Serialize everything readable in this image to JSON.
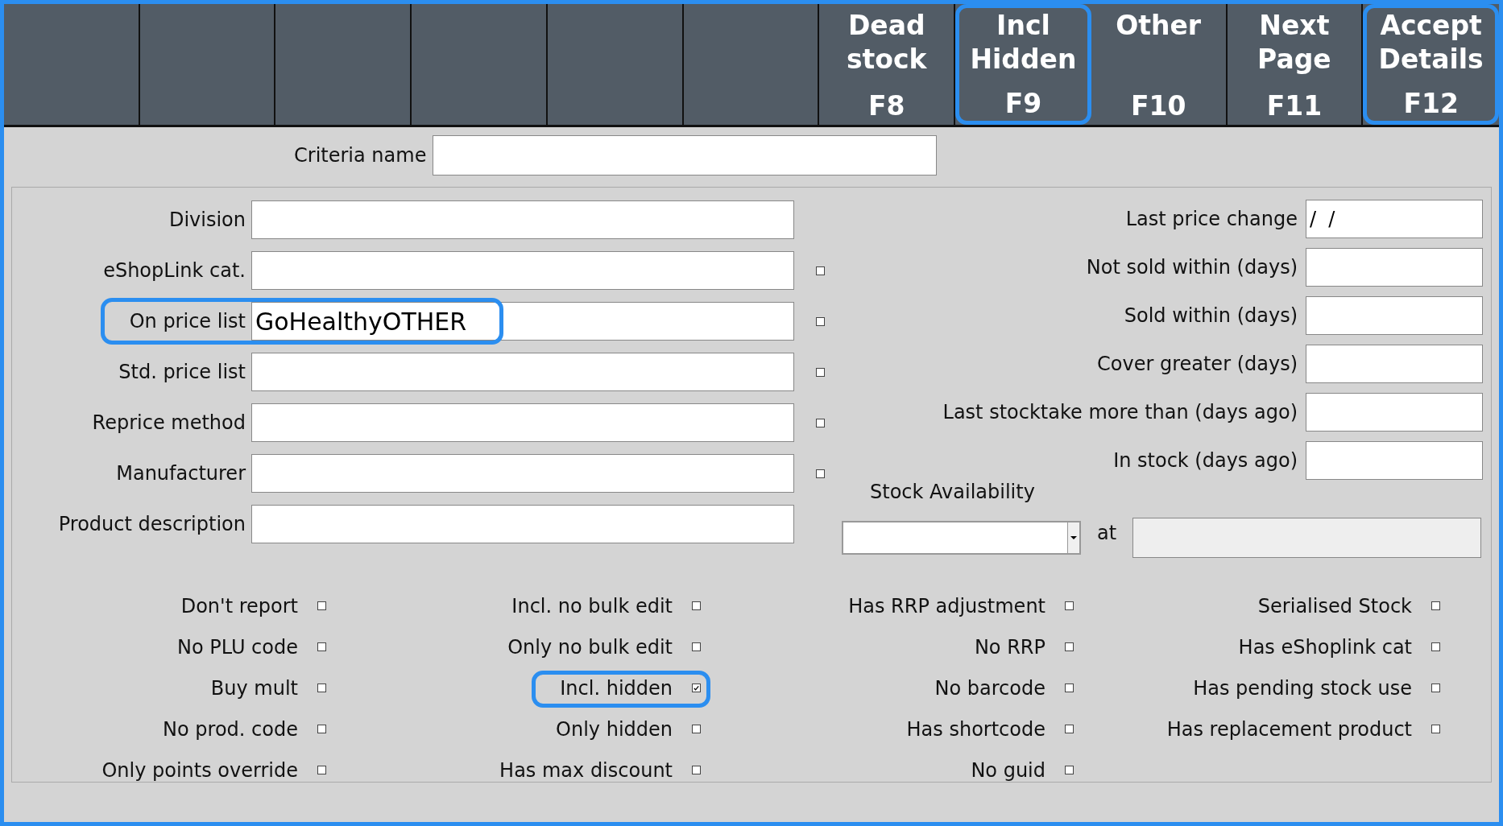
{
  "function_keys": [
    {
      "kind": "blank"
    },
    {
      "kind": "blank"
    },
    {
      "kind": "blank"
    },
    {
      "kind": "blank"
    },
    {
      "kind": "blank"
    },
    {
      "kind": "blank"
    },
    {
      "kind": "key",
      "label": "Dead stock",
      "key": "F8",
      "highlighted": false
    },
    {
      "kind": "key",
      "label": "Incl Hidden",
      "key": "F9",
      "highlighted": true
    },
    {
      "kind": "key",
      "label": "Other",
      "key": "F10",
      "highlighted": false
    },
    {
      "kind": "key",
      "label": "Next Page",
      "key": "F11",
      "highlighted": false
    },
    {
      "kind": "key",
      "label": "Accept Details",
      "key": "F12",
      "highlighted": true
    }
  ],
  "criteria_name": {
    "label": "Criteria name"
  },
  "left_fields": [
    {
      "label": "Division"
    },
    {
      "label": "eShopLink cat.",
      "checked": false
    },
    {
      "label": "On price list",
      "value": "GoHealthyOTHER",
      "checked": false,
      "highlighted": true
    },
    {
      "label": "Std. price list",
      "checked": false
    },
    {
      "label": "Reprice method",
      "checked": false
    },
    {
      "label": "Manufacturer",
      "checked": false
    },
    {
      "label": "Product description"
    }
  ],
  "right_fields": [
    {
      "label": "Last price change",
      "value": "/  /"
    },
    {
      "label": "Not sold within (days)"
    },
    {
      "label": "Sold within (days)"
    },
    {
      "label": "Cover greater (days)"
    },
    {
      "label": "Last stocktake more than (days ago)"
    },
    {
      "label": "In stock (days ago)"
    }
  ],
  "stock_availability": {
    "label": "Stock Availability",
    "at_label": "at"
  },
  "options": [
    [
      {
        "label": "Don't report",
        "checked": false
      },
      {
        "label": "No PLU code",
        "checked": false
      },
      {
        "label": "Buy mult",
        "checked": false
      },
      {
        "label": "No prod. code",
        "checked": false
      },
      {
        "label": "Only points override",
        "checked": false
      }
    ],
    [
      {
        "label": "Incl. no bulk edit",
        "checked": false
      },
      {
        "label": "Only no bulk edit",
        "checked": false
      },
      {
        "label": "Incl. hidden",
        "checked": true,
        "highlighted": true
      },
      {
        "label": "Only hidden",
        "checked": false
      },
      {
        "label": "Has max discount",
        "checked": false
      }
    ],
    [
      {
        "label": "Has RRP adjustment",
        "checked": false
      },
      {
        "label": "No RRP",
        "checked": false
      },
      {
        "label": "No barcode",
        "checked": false
      },
      {
        "label": "Has shortcode",
        "checked": false
      },
      {
        "label": "No guid",
        "checked": false
      }
    ],
    [
      {
        "label": "Serialised Stock",
        "checked": false
      },
      {
        "label": "Has eShoplink cat",
        "checked": false
      },
      {
        "label": "Has pending stock use",
        "checked": false
      },
      {
        "label": "Has replacement product",
        "checked": false
      }
    ]
  ]
}
